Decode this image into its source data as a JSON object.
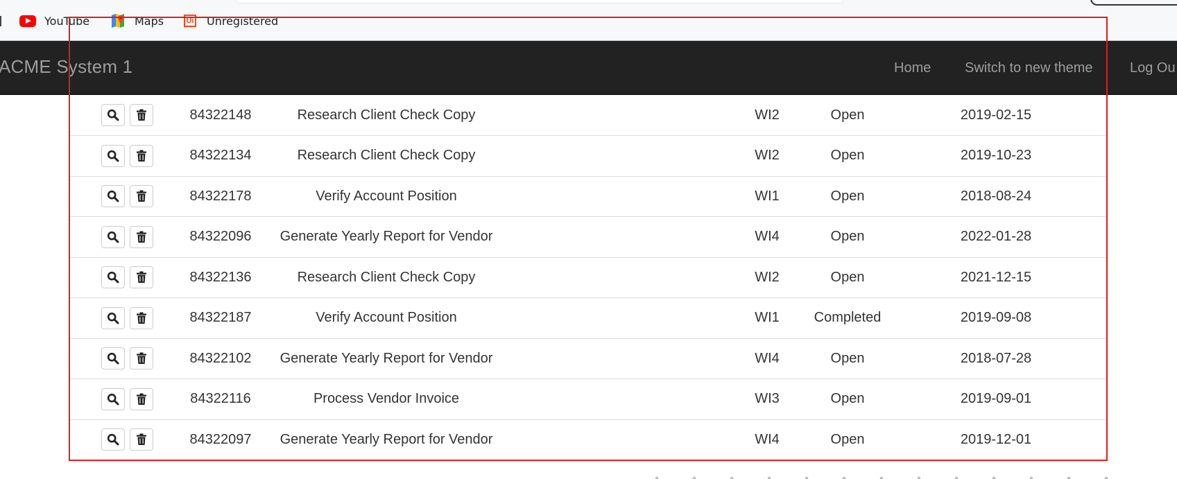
{
  "bookmarks": {
    "items": [
      {
        "label": "YouTube",
        "icon": "youtube-icon"
      },
      {
        "label": "Maps",
        "icon": "maps-icon"
      },
      {
        "label": "Unregistered",
        "icon": "uipath-icon"
      }
    ]
  },
  "navbar": {
    "brand": "ACME System 1",
    "links": [
      "Home",
      "Switch to new theme",
      "Log Ou"
    ]
  },
  "table": {
    "rows": [
      {
        "id": "84322148",
        "description": "Research Client Check Copy",
        "type": "WI2",
        "status": "Open",
        "date": "2019-02-15"
      },
      {
        "id": "84322134",
        "description": "Research Client Check Copy",
        "type": "WI2",
        "status": "Open",
        "date": "2019-10-23"
      },
      {
        "id": "84322178",
        "description": "Verify Account Position",
        "type": "WI1",
        "status": "Open",
        "date": "2018-08-24"
      },
      {
        "id": "84322096",
        "description": "Generate Yearly Report for Vendor",
        "type": "WI4",
        "status": "Open",
        "date": "2022-01-28"
      },
      {
        "id": "84322136",
        "description": "Research Client Check Copy",
        "type": "WI2",
        "status": "Open",
        "date": "2021-12-15"
      },
      {
        "id": "84322187",
        "description": "Verify Account Position",
        "type": "WI1",
        "status": "Completed",
        "date": "2019-09-08"
      },
      {
        "id": "84322102",
        "description": "Generate Yearly Report for Vendor",
        "type": "WI4",
        "status": "Open",
        "date": "2018-07-28"
      },
      {
        "id": "84322116",
        "description": "Process Vendor Invoice",
        "type": "WI3",
        "status": "Open",
        "date": "2019-09-01"
      },
      {
        "id": "84322097",
        "description": "Generate Yearly Report for Vendor",
        "type": "WI4",
        "status": "Open",
        "date": "2019-12-01"
      }
    ],
    "row_actions": [
      "search-icon",
      "trash-icon"
    ]
  },
  "colors": {
    "navbar_bg": "#222222",
    "navbar_text": "#9d9d9d",
    "selection_outline": "#e41a1c",
    "row_border": "#dddddd"
  }
}
